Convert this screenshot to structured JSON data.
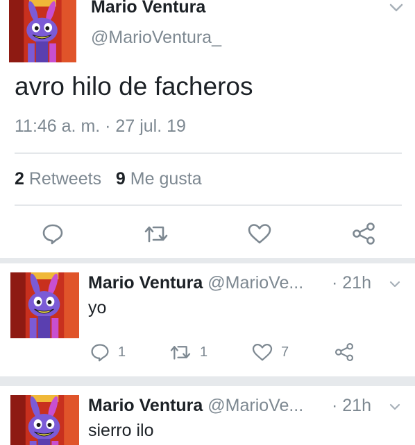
{
  "tweet": {
    "author_name": "Mario Ventura",
    "author_handle": "@MarioVentura_",
    "text": "avro hilo de facheros",
    "timestamp": "11:46 a. m. · 27 jul. 19",
    "retweets_count": "2",
    "retweets_label": " Retweets",
    "likes_count": "9",
    "likes_label": " Me gusta",
    "actions": [
      "reply-icon",
      "retweet-icon",
      "heart-icon",
      "share-icon"
    ]
  },
  "replies": [
    {
      "author_name": "Mario Ventura",
      "author_handle": " @MarioVe...",
      "time": "· 21h",
      "text": "yo",
      "reply_count": "1",
      "retweet_count": "1",
      "like_count": "7"
    },
    {
      "author_name": "Mario Ventura",
      "author_handle": " @MarioVe...",
      "time": "· 21h",
      "text": "sierro ilo"
    }
  ],
  "colors": {
    "text": "#1c2126",
    "secondary": "#7d8891",
    "divider": "#e4e7ea",
    "avatar_character": "#7b5bd6",
    "avatar_background": "#c8301e"
  }
}
